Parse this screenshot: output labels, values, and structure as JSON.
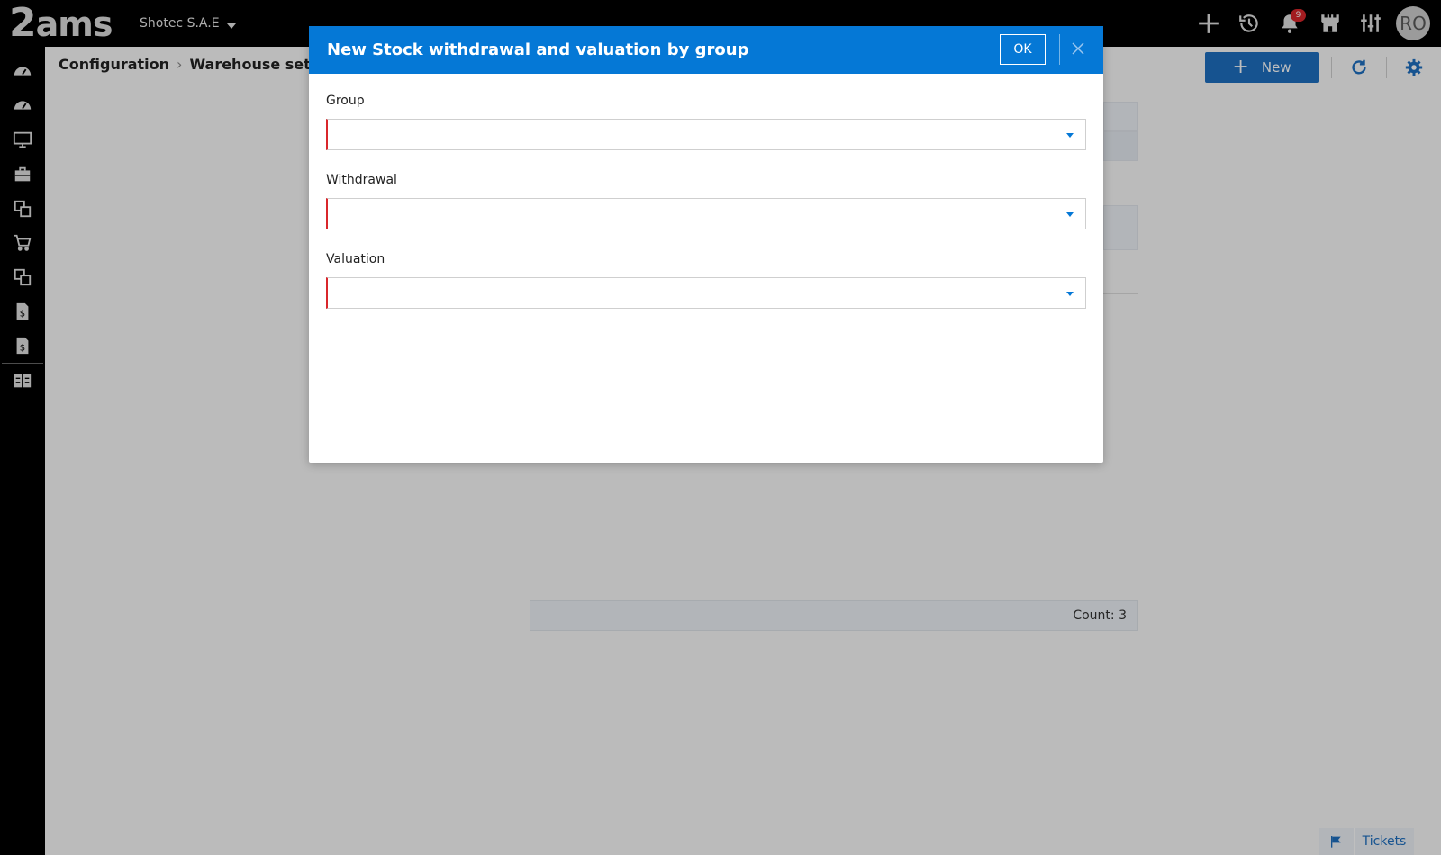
{
  "app": {
    "logo_text": "ams",
    "company": "Shotec S.A.E",
    "notification_count": "9",
    "user_initials": "RO"
  },
  "top_icons": [
    "plus-icon",
    "history-icon",
    "bell-icon",
    "castle-icon",
    "sliders-icon"
  ],
  "sidebar": {
    "items": [
      "dashboard-icon",
      "dashboard-icon",
      "monitor-icon",
      "briefcase-icon",
      "documents-icon",
      "cart-icon",
      "documents-icon",
      "invoice-dollar-icon",
      "invoice-dollar-icon",
      "grid-layout-icon"
    ]
  },
  "breadcrumb": {
    "items": [
      "Configuration",
      "Warehouse settings"
    ]
  },
  "toolbar": {
    "new_label": "New"
  },
  "list": {
    "count_label": "Count: 3"
  },
  "tickets": {
    "label": "Tickets"
  },
  "modal": {
    "title": "New Stock withdrawal and valuation by group",
    "ok_label": "OK",
    "fields": [
      {
        "label": "Group",
        "value": ""
      },
      {
        "label": "Withdrawal",
        "value": ""
      },
      {
        "label": "Valuation",
        "value": ""
      }
    ]
  },
  "colors": {
    "accent": "#0578d6",
    "primary_button": "#1e6fc1",
    "required": "#d9262b",
    "topbar": "#000000"
  }
}
